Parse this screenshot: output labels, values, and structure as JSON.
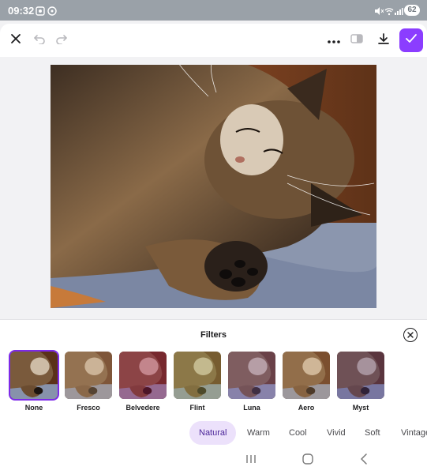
{
  "status_bar": {
    "time": "09:32",
    "battery": "62",
    "left_icons": [
      "screenshot-icon",
      "whatsapp-icon"
    ],
    "right_icons": [
      "mute-icon",
      "wifi-icon",
      "signal-icon"
    ]
  },
  "toolbar": {
    "icons": [
      "close-icon",
      "undo-icon",
      "redo-icon",
      "more-icon",
      "compare-icon",
      "download-icon",
      "confirm-icon"
    ],
    "accent": "#8b3dff"
  },
  "filters_panel": {
    "title": "Filters",
    "items": [
      {
        "label": "None",
        "tint": "#00000000",
        "selected": true
      },
      {
        "label": "Fresco",
        "tint": "#c8a27a55"
      },
      {
        "label": "Belvedere",
        "tint": "#b2185a55"
      },
      {
        "label": "Flint",
        "tint": "#b0b46055"
      },
      {
        "label": "Luna",
        "tint": "#8a64a855"
      },
      {
        "label": "Aero",
        "tint": "#d7a47244"
      },
      {
        "label": "Myst",
        "tint": "#5a3f8a55"
      }
    ],
    "categories": [
      "Natural",
      "Warm",
      "Cool",
      "Vivid",
      "Soft",
      "Vintage"
    ],
    "active_category": "Natural",
    "selected_color": "#7d2ae8"
  },
  "nav_bar": {
    "icons": [
      "recents-icon",
      "home-icon",
      "back-icon"
    ]
  }
}
